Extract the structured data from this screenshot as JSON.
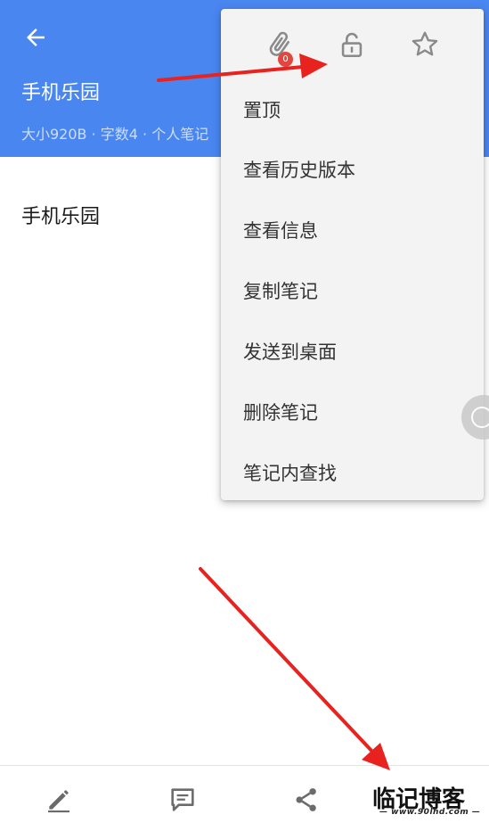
{
  "header": {
    "title": "手机乐园",
    "meta": "大小920B · 字数4 · 个人笔记"
  },
  "note": {
    "body_text": "手机乐园"
  },
  "popup": {
    "attachment_badge": "0",
    "icons": [
      "attachment-icon",
      "unlock-icon",
      "star-icon"
    ],
    "menu": [
      "置顶",
      "查看历史版本",
      "查看信息",
      "复制笔记",
      "发送到桌面",
      "删除笔记",
      "笔记内查找"
    ]
  },
  "bottom_bar": {
    "icons": [
      "edit-icon",
      "comment-icon",
      "share-icon"
    ]
  },
  "watermark": {
    "text": "临记博客",
    "url": "— www.90lhd.com —"
  },
  "colors": {
    "header_bg": "#4a86f0",
    "popup_bg": "#f3f3f3",
    "badge": "#e5453c",
    "annotation_arrow": "#e8231f"
  }
}
